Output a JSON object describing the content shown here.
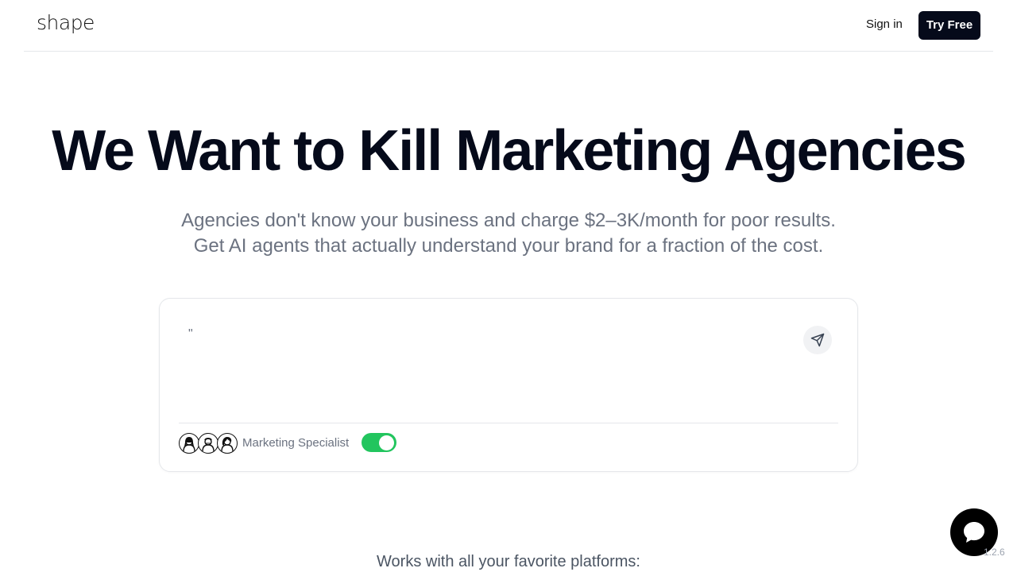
{
  "header": {
    "logo": "shape",
    "signin_label": "Sign in",
    "tryfree_label": "Try Free"
  },
  "hero": {
    "title": "We Want to Kill Marketing Agencies",
    "subtitle_line1": "Agencies don't know your business and charge $2–3K/month for poor results.",
    "subtitle_line2": "Get AI agents that actually understand your brand for a fraction of the cost."
  },
  "prompt_card": {
    "input_value": "\"",
    "send_icon": "send-icon",
    "agent_label": "Marketing Specialist",
    "toggle_on": true,
    "toggle_color": "#22c55e"
  },
  "footer": {
    "platforms_text": "Works with all your favorite platforms:",
    "version": "1.2.6",
    "chat_icon": "chat-bubble-icon"
  }
}
